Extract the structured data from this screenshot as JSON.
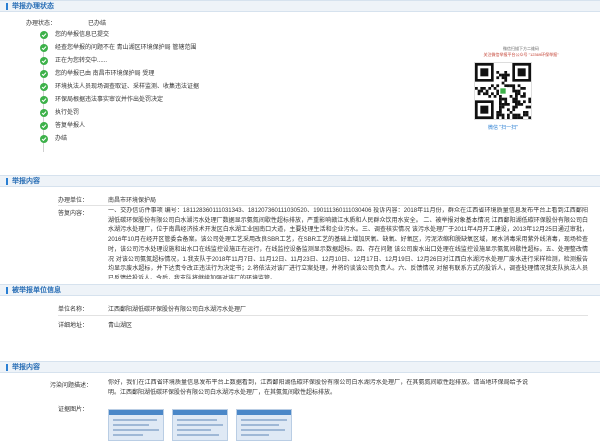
{
  "sections": {
    "status": "举报办理状态",
    "content": "举报内容",
    "target": "被举报单位信息",
    "complaint": "举报内容"
  },
  "status": {
    "label": "办理状态：",
    "value": "已办结"
  },
  "steps": [
    "您的举报信息已提交",
    "经查您举报的问题不在 青山湖区环境保护局 管辖范围",
    "正在为您转交中......",
    "您的举报已由 南昌市环境保护局 受理",
    "环境执法人员现场调查取证、采样监测、收集违法证据",
    "环保局根据违法事实审议并作出处罚决定",
    "执行处罚",
    "答复举报人",
    "办结"
  ],
  "qr": {
    "line1": "微信扫描下方二维码",
    "line2": "关注微信举报平台公众号 \"12369环保举报\"",
    "caption": "微信 \"扫一扫\""
  },
  "content": {
    "unit_label": "办理单位：",
    "unit_value": "南昌市环境保护局",
    "reply_label": "答复内容：",
    "reply_text": "一、交办信访件事项 编号：181128360111031343、181207360111030520、190111360111030406 投诉内容：2018年11月份，群众在江西省环境质量信息发布平台上看到江西鄱阳湖低碳环保股份有限公司白水湖污水处理厂数据显示氨氮间歇性超标排放，严重影响赣江水质和人民群众饮用水安全。 二、被举报对象基本情况 江西鄱阳湖低碳环保股份有限公司白水湖污水处理厂，位于南昌经济技术开发区白水湖工业园南口大道，主要处理生活和企业污水。三、调查核实情况 该污水处理厂于2011年4月开工建设，2013年12月25日通过审批，2016年10月在经开区管委会备案。该公司处理工艺采用改良SBR工艺，在SBR工艺的基础上增加厌氧、缺氧、好氧区，污泥浓缩和脱缺氧区域，尾水消毒采用紫外线消毒，现场检查时，该公司污水处理设施和出水口在线监控设施正在运行，在线监控设备监测显示数据超标。四、存在问题 该公司废水出口处理在线监控设施显示氨氮间歇性超标。五、处理整改情况 对该公司氨氮超标情况，1.我支队于2018年11月7日、11月12日、11月23日、12月10日、12月17日、12月19日、12月26日对江西白水湖污水处理厂废水进行采样检测，检测报告均显示废水超标，并下达责令改正违法行为决定书；2.将依法对该厂进行立案处理，并将约谈该公司负责人。六、反馈情况 对留有联系方式的投诉人，调查处理情况我支队执法人员已反馈给投诉人。今后，我支队将继续加强对该厂的环境监管。"
  },
  "target": {
    "name_label": "单位名称：",
    "name_value": "江西鄱阳湖低碳环保股份有限公司白水湖污水处理厂",
    "address_label": "详细地址：",
    "address_value": "青山湖区"
  },
  "complaint": {
    "issue_label": "污染问题描述：",
    "issue_text": "你好，我们在江西省环境质量信息发布平台上数据看到，江西鄱阳湖低碳环保股份有限公司白水湖污水处理厂，在其氨氮间歇性超排放。请当地环保局给予说明。江西鄱阳湖低碳环保股份有限公司白水湖污水处理厂，在其氨氮间歇性超标排放。",
    "evidence_label": "证据图片："
  },
  "colors": {
    "accent": "#2a7fd3",
    "check": "#3db14a"
  },
  "icons": [
    "check-circle-icon",
    "qr-code-icon",
    "evidence-image-thumbnail"
  ]
}
